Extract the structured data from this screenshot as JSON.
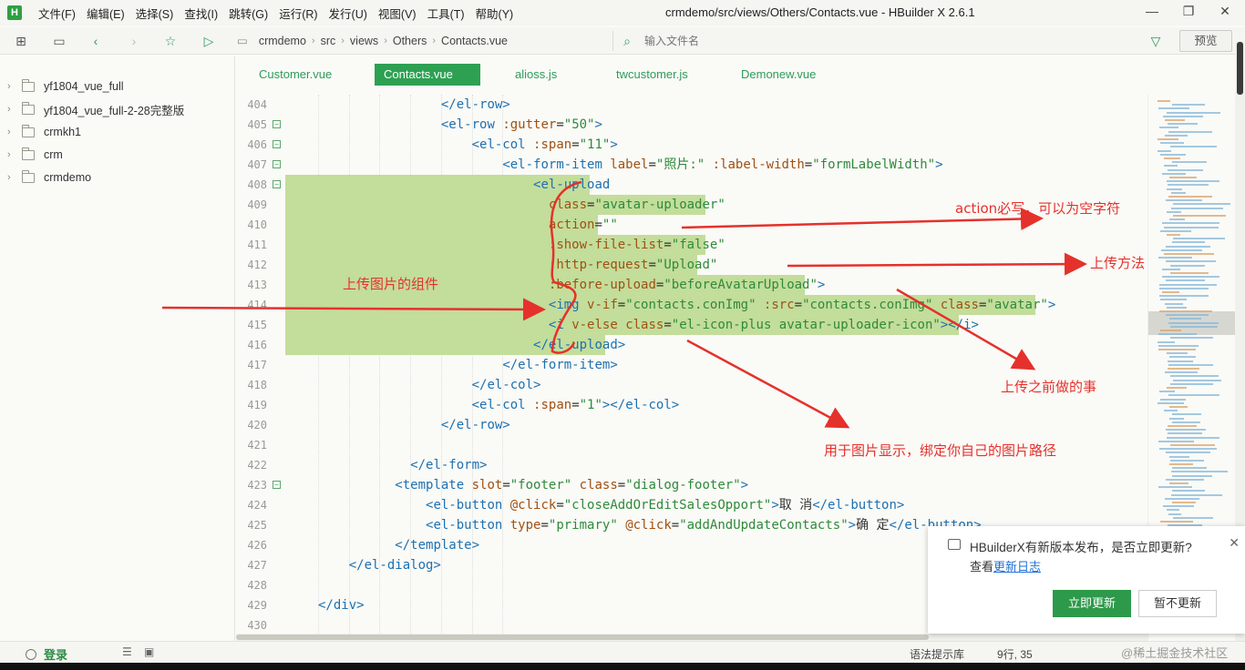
{
  "app": {
    "title": "crmdemo/src/views/Others/Contacts.vue - HBuilder X 2.6.1",
    "logo_text": "H"
  },
  "menu": [
    "文件(F)",
    "编辑(E)",
    "选择(S)",
    "查找(I)",
    "跳转(G)",
    "运行(R)",
    "发行(U)",
    "视图(V)",
    "工具(T)",
    "帮助(Y)"
  ],
  "breadcrumb": [
    "crmdemo",
    "src",
    "views",
    "Others",
    "Contacts.vue"
  ],
  "search": {
    "placeholder": "输入文件名"
  },
  "preview_label": "预览",
  "sidebar": {
    "items": [
      {
        "label": "yf1804_vue_full"
      },
      {
        "label": "yf1804_vue_full-2-28完整版"
      },
      {
        "label": "crmkh1"
      },
      {
        "label": "crm"
      },
      {
        "label": "crmdemo"
      }
    ]
  },
  "tabs": [
    {
      "label": "Customer.vue",
      "active": false
    },
    {
      "label": "Contacts.vue",
      "active": true
    },
    {
      "label": "alioss.js",
      "active": false
    },
    {
      "label": "twcustomer.js",
      "active": false
    },
    {
      "label": "Demonew.vue",
      "active": false
    }
  ],
  "code_lines": [
    {
      "n": "404",
      "fold": false,
      "indent": 16,
      "hl": false,
      "tokens": [
        {
          "t": "tag",
          "v": "</el-row>"
        }
      ]
    },
    {
      "n": "405",
      "fold": true,
      "indent": 16,
      "hl": false,
      "tokens": [
        {
          "t": "tag",
          "v": "<el-row "
        },
        {
          "t": "attr",
          "v": ":gutter"
        },
        {
          "t": "txt",
          "v": "="
        },
        {
          "t": "str",
          "v": "\"50\""
        },
        {
          "t": "tag",
          "v": ">"
        }
      ]
    },
    {
      "n": "406",
      "fold": true,
      "indent": 20,
      "hl": false,
      "tokens": [
        {
          "t": "tag",
          "v": "<el-col "
        },
        {
          "t": "attr",
          "v": ":span"
        },
        {
          "t": "txt",
          "v": "="
        },
        {
          "t": "str",
          "v": "\"11\""
        },
        {
          "t": "tag",
          "v": ">"
        }
      ]
    },
    {
      "n": "407",
      "fold": true,
      "indent": 24,
      "hl": false,
      "tokens": [
        {
          "t": "tag",
          "v": "<el-form-item "
        },
        {
          "t": "attr",
          "v": "label"
        },
        {
          "t": "txt",
          "v": "="
        },
        {
          "t": "str",
          "v": "\"照片:\" "
        },
        {
          "t": "attr",
          "v": ":label-width"
        },
        {
          "t": "txt",
          "v": "="
        },
        {
          "t": "str",
          "v": "\"formLabelWidth\""
        },
        {
          "t": "tag",
          "v": ">"
        }
      ]
    },
    {
      "n": "408",
      "fold": true,
      "indent": 28,
      "hl": true,
      "tokens": [
        {
          "t": "tag",
          "v": "<el-upload"
        }
      ]
    },
    {
      "n": "409",
      "fold": false,
      "indent": 30,
      "hl": true,
      "tokens": [
        {
          "t": "attr",
          "v": "class"
        },
        {
          "t": "txt",
          "v": "="
        },
        {
          "t": "str",
          "v": "\"avatar-uploader\""
        }
      ]
    },
    {
      "n": "410",
      "fold": false,
      "indent": 30,
      "hl": true,
      "tokens": [
        {
          "t": "attr",
          "v": "action"
        },
        {
          "t": "txt",
          "v": "="
        },
        {
          "t": "str",
          "v": "\"\""
        }
      ]
    },
    {
      "n": "411",
      "fold": false,
      "indent": 30,
      "hl": true,
      "tokens": [
        {
          "t": "attr",
          "v": ":show-file-list"
        },
        {
          "t": "txt",
          "v": "="
        },
        {
          "t": "str",
          "v": "\"false\""
        }
      ]
    },
    {
      "n": "412",
      "fold": false,
      "indent": 30,
      "hl": true,
      "tokens": [
        {
          "t": "attr",
          "v": ":http-request"
        },
        {
          "t": "txt",
          "v": "="
        },
        {
          "t": "str",
          "v": "\"Upload\""
        }
      ]
    },
    {
      "n": "413",
      "fold": false,
      "indent": 30,
      "hl": true,
      "tokens": [
        {
          "t": "attr",
          "v": ":before-upload"
        },
        {
          "t": "txt",
          "v": "="
        },
        {
          "t": "str",
          "v": "\"beforeAvatarUpload\""
        },
        {
          "t": "tag",
          "v": ">"
        }
      ]
    },
    {
      "n": "414",
      "fold": false,
      "indent": 30,
      "hl": true,
      "tokens": [
        {
          "t": "tag",
          "v": "<img "
        },
        {
          "t": "attr",
          "v": "v-if"
        },
        {
          "t": "txt",
          "v": "="
        },
        {
          "t": "str",
          "v": "\"contacts.conImg\" "
        },
        {
          "t": "attr",
          "v": ":src"
        },
        {
          "t": "txt",
          "v": "="
        },
        {
          "t": "str",
          "v": "\"contacts.conImg\" "
        },
        {
          "t": "attr",
          "v": "class"
        },
        {
          "t": "txt",
          "v": "="
        },
        {
          "t": "str",
          "v": "\"avatar\""
        },
        {
          "t": "tag",
          "v": ">"
        }
      ]
    },
    {
      "n": "415",
      "fold": false,
      "indent": 30,
      "hl": true,
      "tokens": [
        {
          "t": "tag",
          "v": "<i "
        },
        {
          "t": "attr",
          "v": "v-else "
        },
        {
          "t": "attr",
          "v": "class"
        },
        {
          "t": "txt",
          "v": "="
        },
        {
          "t": "str",
          "v": "\"el-icon-plus avatar-uploader-icon\""
        },
        {
          "t": "tag",
          "v": "></i>"
        }
      ]
    },
    {
      "n": "416",
      "fold": false,
      "indent": 28,
      "hl": true,
      "tokens": [
        {
          "t": "tag",
          "v": "</el-upload>"
        }
      ]
    },
    {
      "n": "417",
      "fold": false,
      "indent": 24,
      "hl": false,
      "tokens": [
        {
          "t": "tag",
          "v": "</el-form-item>"
        }
      ]
    },
    {
      "n": "418",
      "fold": false,
      "indent": 20,
      "hl": false,
      "tokens": [
        {
          "t": "tag",
          "v": "</el-col>"
        }
      ]
    },
    {
      "n": "419",
      "fold": false,
      "indent": 20,
      "hl": false,
      "tokens": [
        {
          "t": "tag",
          "v": "<el-col "
        },
        {
          "t": "attr",
          "v": ":span"
        },
        {
          "t": "txt",
          "v": "="
        },
        {
          "t": "str",
          "v": "\"1\""
        },
        {
          "t": "tag",
          "v": "></el-col>"
        }
      ]
    },
    {
      "n": "420",
      "fold": false,
      "indent": 16,
      "hl": false,
      "tokens": [
        {
          "t": "tag",
          "v": "</el-row>"
        }
      ]
    },
    {
      "n": "421",
      "fold": false,
      "indent": 0,
      "hl": false,
      "tokens": []
    },
    {
      "n": "422",
      "fold": false,
      "indent": 12,
      "hl": false,
      "tokens": [
        {
          "t": "tag",
          "v": "</el-form>"
        }
      ]
    },
    {
      "n": "423",
      "fold": true,
      "indent": 10,
      "hl": false,
      "tokens": [
        {
          "t": "tag",
          "v": "<template "
        },
        {
          "t": "attr",
          "v": "slot"
        },
        {
          "t": "txt",
          "v": "="
        },
        {
          "t": "str",
          "v": "\"footer\" "
        },
        {
          "t": "attr",
          "v": "class"
        },
        {
          "t": "txt",
          "v": "="
        },
        {
          "t": "str",
          "v": "\"dialog-footer\""
        },
        {
          "t": "tag",
          "v": ">"
        }
      ]
    },
    {
      "n": "424",
      "fold": false,
      "indent": 14,
      "hl": false,
      "tokens": [
        {
          "t": "tag",
          "v": "<el-button "
        },
        {
          "t": "attr",
          "v": "@click"
        },
        {
          "t": "txt",
          "v": "="
        },
        {
          "t": "str",
          "v": "\"closeAddOrEditSalesOpport\""
        },
        {
          "t": "tag",
          "v": ">"
        },
        {
          "t": "txt",
          "v": "取 消"
        },
        {
          "t": "tag",
          "v": "</el-button>"
        }
      ]
    },
    {
      "n": "425",
      "fold": false,
      "indent": 14,
      "hl": false,
      "tokens": [
        {
          "t": "tag",
          "v": "<el-button "
        },
        {
          "t": "attr",
          "v": "type"
        },
        {
          "t": "txt",
          "v": "="
        },
        {
          "t": "str",
          "v": "\"primary\" "
        },
        {
          "t": "attr",
          "v": "@click"
        },
        {
          "t": "txt",
          "v": "="
        },
        {
          "t": "str",
          "v": "\"addAndUpdateContacts\""
        },
        {
          "t": "tag",
          "v": ">"
        },
        {
          "t": "txt",
          "v": "确 定"
        },
        {
          "t": "tag",
          "v": "</el-button>"
        }
      ]
    },
    {
      "n": "426",
      "fold": false,
      "indent": 10,
      "hl": false,
      "tokens": [
        {
          "t": "tag",
          "v": "</template>"
        }
      ]
    },
    {
      "n": "427",
      "fold": false,
      "indent": 4,
      "hl": false,
      "tokens": [
        {
          "t": "tag",
          "v": "</el-dialog>"
        }
      ]
    },
    {
      "n": "428",
      "fold": false,
      "indent": 0,
      "hl": false,
      "tokens": []
    },
    {
      "n": "429",
      "fold": false,
      "indent": 0,
      "hl": false,
      "tokens": [
        {
          "t": "tag",
          "v": "</div>"
        }
      ]
    },
    {
      "n": "430",
      "fold": false,
      "indent": 0,
      "hl": false,
      "tokens": []
    }
  ],
  "annotations": {
    "action": "action必写，可以为空字符",
    "upload_method": "上传方法",
    "component": "上传图片的组件",
    "before": "上传之前做的事",
    "display": "用于图片显示，绑定你自己的图片路径",
    "color": "#e5312b"
  },
  "notification": {
    "message": "HBuilderX有新版本发布，是否立即更新?",
    "sub_prefix": "查看",
    "link": "更新日志",
    "primary": "立即更新",
    "secondary": "暂不更新"
  },
  "status": {
    "login": "登录",
    "hint_lib": "语法提示库",
    "position": "9行, 35",
    "watermark": "@稀土掘金技术社区"
  },
  "colors": {
    "accent": "#2ea052",
    "highlight": "#c3dd9b"
  }
}
